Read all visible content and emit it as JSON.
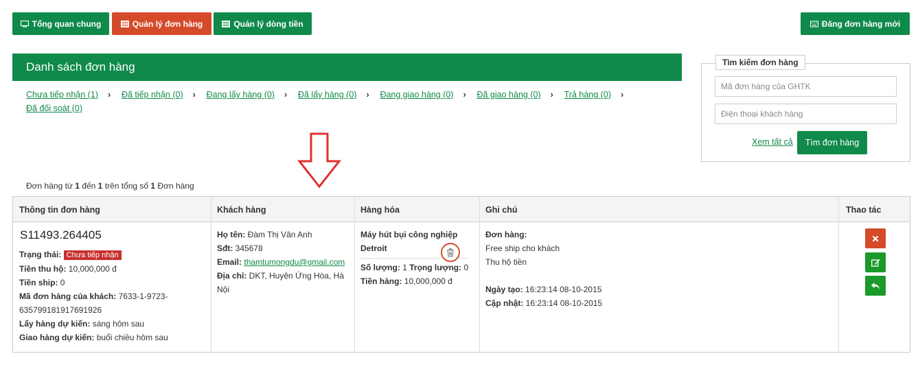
{
  "nav": {
    "overview": "Tổng quan chung",
    "orders": "Quản lý đơn hàng",
    "cashflow": "Quản lý dòng tiền",
    "new_order": "Đăng đơn hàng mới"
  },
  "list_title": "Danh sách đơn hàng",
  "status_links": [
    "Chưa tiếp nhận (1)",
    "Đã tiếp nhận (0)",
    "Đang lấy hàng (0)",
    "Đã lấy hàng (0)",
    "Đang giao hàng (0)",
    "Đã giao hàng (0)",
    "Trả hàng (0)",
    "Đã đối soát (0)"
  ],
  "search": {
    "legend": "Tìm kiếm đơn hàng",
    "order_placeholder": "Mã đơn hàng của GHTK",
    "phone_placeholder": "Điện thoại khách hàng",
    "view_all": "Xem tất cả",
    "submit": "Tìm đơn hàng"
  },
  "summary": {
    "prefix": "Đơn hàng từ ",
    "from": "1",
    "mid1": " đến ",
    "to": "1",
    "mid2": " trên tổng số ",
    "total": "1",
    "suffix": " Đơn hàng"
  },
  "table": {
    "headers": [
      "Thông tin đơn hàng",
      "Khách hàng",
      "Hàng hóa",
      "Ghi chú",
      "Thao tác"
    ]
  },
  "order": {
    "code": "S11493.264405",
    "status_label": "Trạng thái:",
    "status_value": "Chưa tiếp nhận",
    "cod_label": "Tiền thu hộ:",
    "cod_value": " 10,000,000 đ",
    "ship_label": "Tiền ship:",
    "ship_value": " 0",
    "client_code_label": "Mã đơn hàng của khách:",
    "client_code_value": " 7633-1-9723-",
    "client_code_value2": "635799181917691926",
    "pickup_label": "Lấy hàng dự kiến:",
    "pickup_value": " sáng hôm sau",
    "deliver_label": "Giao hàng dự kiến:",
    "deliver_value": " buổi chiều hôm sau"
  },
  "customer": {
    "name_label": "Họ tên:",
    "name_value": " Đàm Thị Vân Anh",
    "phone_label": "Sđt:",
    "phone_value": " 345678",
    "email_label": "Email:",
    "email_value": "thamtumongdu@gmail.com",
    "address_label": "Địa chỉ:",
    "address_value": " DKT, Huyện Ứng Hòa, Hà",
    "address_value2": "Nội"
  },
  "goods": {
    "name_line1": "Máy hút bụi công nghiệp",
    "name_line2": "Detroit",
    "qty_label": "Số lượng:",
    "qty_value": " 1 ",
    "weight_label": "Trọng lượng:",
    "weight_value": " 0",
    "amount_label": "Tiền hàng:",
    "amount_value": " 10,000,000 đ"
  },
  "note": {
    "order_label": "Đơn hàng:",
    "line1": "Free ship cho khách",
    "line2": "Thu hộ tiền",
    "created_label": "Ngày tạo:",
    "created_value": " 16:23:14 08-10-2015",
    "updated_label": "Cập nhật:",
    "updated_value": " 16:23:14 08-10-2015"
  },
  "colors": {
    "brand_green": "#0f8a4a",
    "active_red": "#d54b2a",
    "badge_red": "#c9302c"
  },
  "icons": {
    "overview": "monitor-icon",
    "orders": "list-icon",
    "cashflow": "list-icon",
    "new_order": "keyboard-icon",
    "delete_goods": "trash-icon",
    "delete_order": "close-icon",
    "edit_order": "edit-icon",
    "return_order": "reply-icon"
  }
}
